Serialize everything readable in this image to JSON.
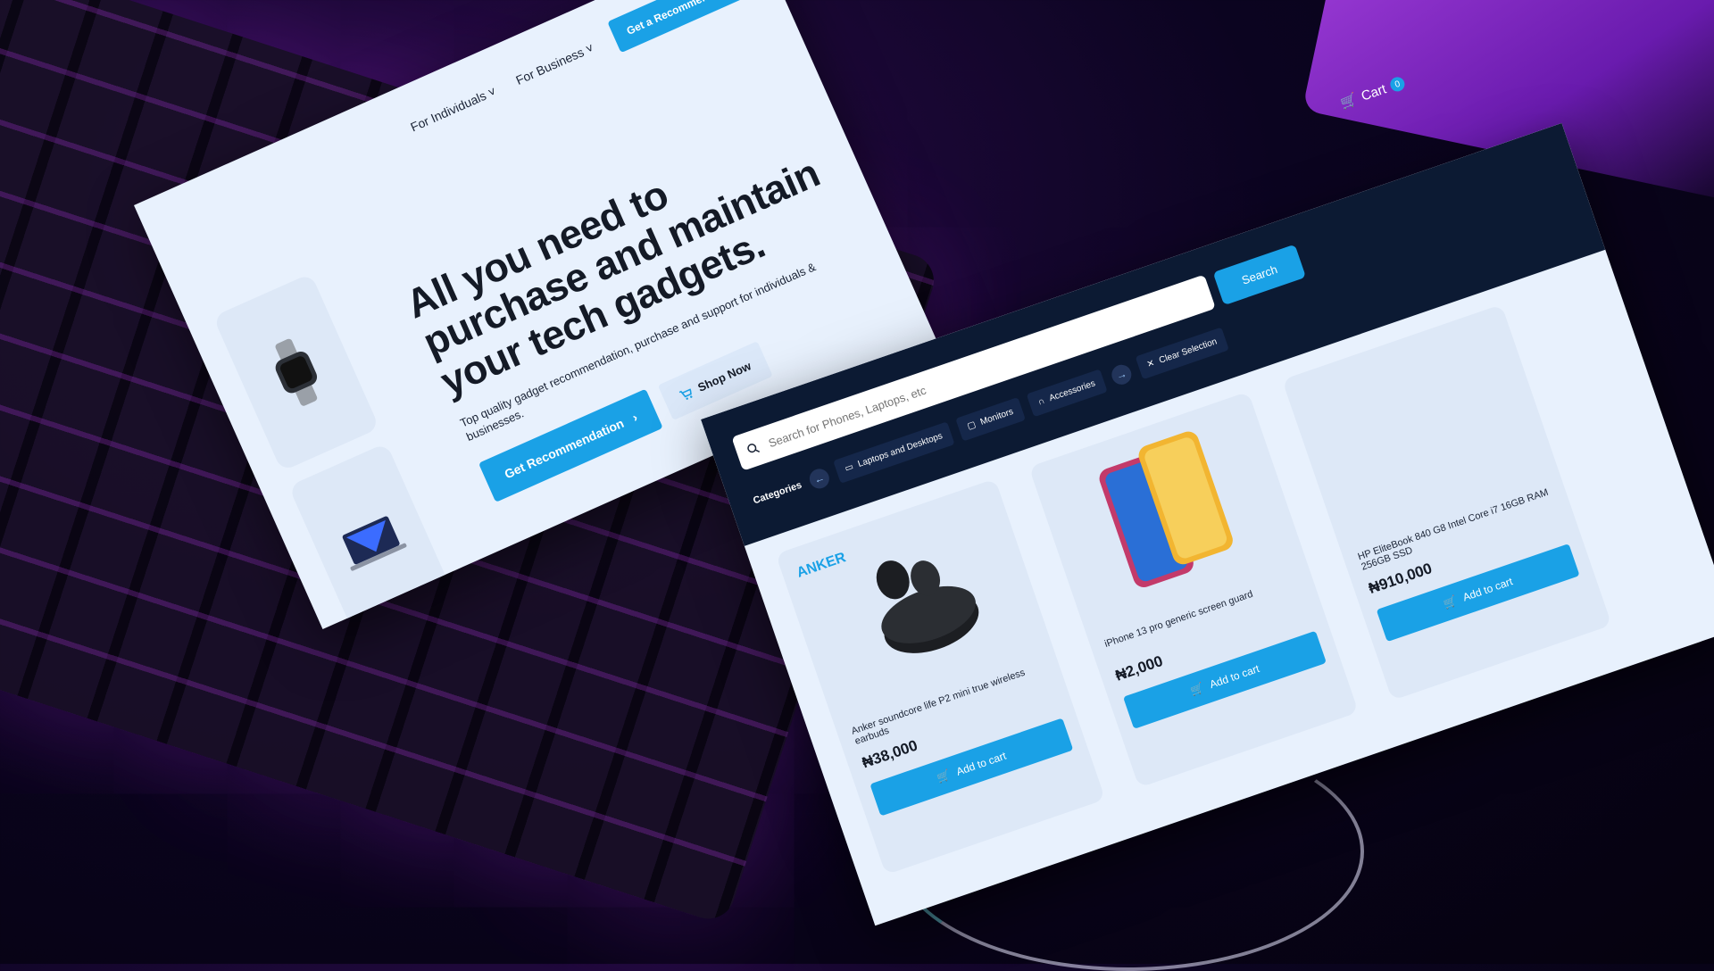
{
  "colors": {
    "accent": "#1aa1e6",
    "navy": "#0c1a33",
    "panel": "#e8f1fd"
  },
  "left": {
    "nav": {
      "individuals": "For Individuals",
      "business": "For Business",
      "cta": "Get a Recommendation"
    },
    "hero": {
      "title": "All you need to purchase and maintain your tech gadgets.",
      "subtitle": "Top quality gadget recommendation, purchase and support for individuals & businesses.",
      "primary": "Get Recommendation",
      "secondary": "Shop Now"
    },
    "thumbs": [
      {
        "icon": "smartwatch-icon"
      },
      {
        "icon": "laptop-icon"
      },
      {
        "icon": "backpack-icon"
      }
    ]
  },
  "right": {
    "cart": {
      "label": "Cart",
      "count": "0"
    },
    "search": {
      "placeholder": "Search for Phones, Laptops, etc",
      "button": "Search"
    },
    "categories": {
      "label": "Categories",
      "chips": [
        "Laptops and Desktops",
        "Monitors",
        "Accessories"
      ],
      "clear": "Clear Selection"
    },
    "products": [
      {
        "brand": "ANKER",
        "name": "Anker soundcore life P2 mini true wireless earbuds",
        "price": "₦38,000",
        "add": "Add to cart"
      },
      {
        "brand": "",
        "name": "iPhone 13 pro generic screen guard",
        "price": "₦2,000",
        "add": "Add to cart"
      },
      {
        "brand": "",
        "name": "HP EliteBook 840 G8 Intel Core i7 16GB RAM 256GB SSD",
        "price": "₦910,000",
        "add": "Add to cart"
      }
    ]
  }
}
